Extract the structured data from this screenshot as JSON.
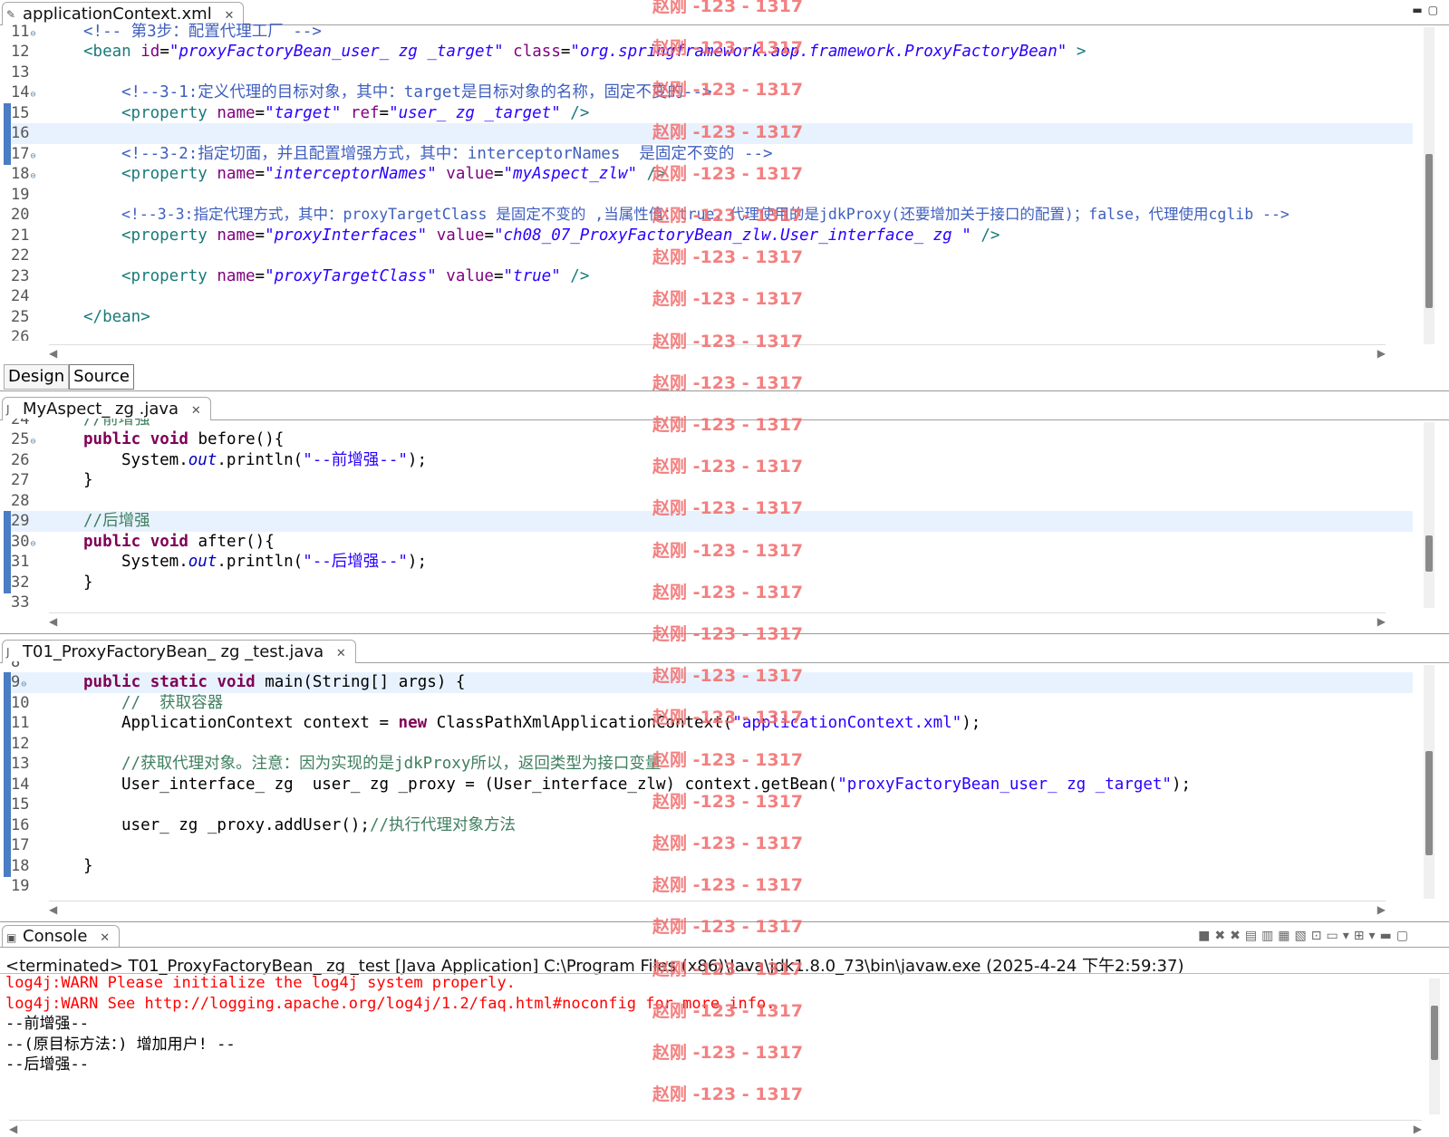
{
  "xml_editor": {
    "tab_title": "applicationContext.xml",
    "lines": [
      {
        "n": "11",
        "text": "<!-- 第3步：配置代理工厂 -->"
      },
      {
        "n": "12",
        "text": "<bean id=\"proxyFactoryBean_user_ zg _target\" class=\"org.springframework.aop.framework.ProxyFactoryBean\" >"
      },
      {
        "n": "13",
        "text": ""
      },
      {
        "n": "14",
        "text": "<!--3-1:定义代理的目标对象，其中：target是目标对象的名称，固定不变的-->"
      },
      {
        "n": "15",
        "text": "<property name=\"target\" ref=\"user_ zg _target\" />"
      },
      {
        "n": "16",
        "text": ""
      },
      {
        "n": "17",
        "text": "<!--3-2:指定切面，并且配置增强方式，其中：interceptorNames  是固定不变的 -->"
      },
      {
        "n": "18",
        "text": "<property name=\"interceptorNames\" value=\"myAspect_zlw\" />"
      },
      {
        "n": "19",
        "text": ""
      },
      {
        "n": "20",
        "text": "<!--3-3:指定代理方式，其中：proxyTargetClass 是固定不变的 ,当属性值：true，代理使用的是jdkProxy(还要增加关于接口的配置)；false，代理使用cglib -->"
      },
      {
        "n": "21",
        "text": "<property name=\"proxyInterfaces\" value=\"ch08_07_ProxyFactoryBean_zlw.User_interface_ zg \" />"
      },
      {
        "n": "22",
        "text": ""
      },
      {
        "n": "23",
        "text": "<property name=\"proxyTargetClass\" value=\"true\" />"
      },
      {
        "n": "24",
        "text": ""
      },
      {
        "n": "25",
        "text": "</bean>"
      },
      {
        "n": "26",
        "text": ""
      }
    ],
    "bottom_tabs": [
      "Design",
      "Source"
    ]
  },
  "aspect_editor": {
    "tab_title": "MyAspect_ zg .java",
    "lines": [
      {
        "n": "24",
        "text": "//前增强"
      },
      {
        "n": "25",
        "text": "public void before(){"
      },
      {
        "n": "26",
        "text": "System.out.println(\"--前增强--\");"
      },
      {
        "n": "27",
        "text": "}"
      },
      {
        "n": "28",
        "text": ""
      },
      {
        "n": "29",
        "text": "//后增强"
      },
      {
        "n": "30",
        "text": "public void after(){"
      },
      {
        "n": "31",
        "text": "System.out.println(\"--后增强--\");"
      },
      {
        "n": "32",
        "text": "}"
      },
      {
        "n": "33",
        "text": ""
      }
    ]
  },
  "test_editor": {
    "tab_title": "T01_ProxyFactoryBean_ zg _test.java",
    "lines": [
      {
        "n": "8",
        "text": ""
      },
      {
        "n": "9",
        "text": "public static void main(String[] args) {"
      },
      {
        "n": "10",
        "text": "//  获取容器"
      },
      {
        "n": "11",
        "text": "ApplicationContext context = new ClassPathXmlApplicationContext(\"applicationContext.xml\");"
      },
      {
        "n": "12",
        "text": ""
      },
      {
        "n": "13",
        "text": "//获取代理对象。注意：因为实现的是jdkProxy所以，返回类型为接口变量"
      },
      {
        "n": "14",
        "text": "User_interface_ zg  user_ zg _proxy = (User_interface_zlw) context.getBean(\"proxyFactoryBean_user_ zg _target\");"
      },
      {
        "n": "15",
        "text": ""
      },
      {
        "n": "16",
        "text": "user_ zg _proxy.addUser();//执行代理对象方法"
      },
      {
        "n": "17",
        "text": ""
      },
      {
        "n": "18",
        "text": "}"
      },
      {
        "n": "19",
        "text": ""
      }
    ]
  },
  "console": {
    "tab_title": "Console",
    "status": "<terminated> T01_ProxyFactoryBean_ zg _test [Java Application] C:\\Program Files (x86)\\Java\\jdk1.8.0_73\\bin\\javaw.exe (2025-4-24 下午2:59:37)",
    "output": [
      "log4j:WARN Please initialize the log4j system properly.",
      "log4j:WARN See http://logging.apache.org/log4j/1.2/faq.html#noconfig for more info.",
      "--前增强--",
      "--(原目标方法：) 增加用户! --",
      "--后增强--"
    ]
  },
  "watermark": {
    "text": "赵刚 -123 - 1317"
  },
  "colors": {
    "keyword": "#7f0055",
    "xml_tag": "#1a7a7a",
    "xml_attr": "#7f007f",
    "string": "#2a00ff",
    "comment": "#3f5fbf",
    "error": "#ff0000",
    "watermark": "#f26a6a",
    "change_bar": "#4a7dc3"
  }
}
